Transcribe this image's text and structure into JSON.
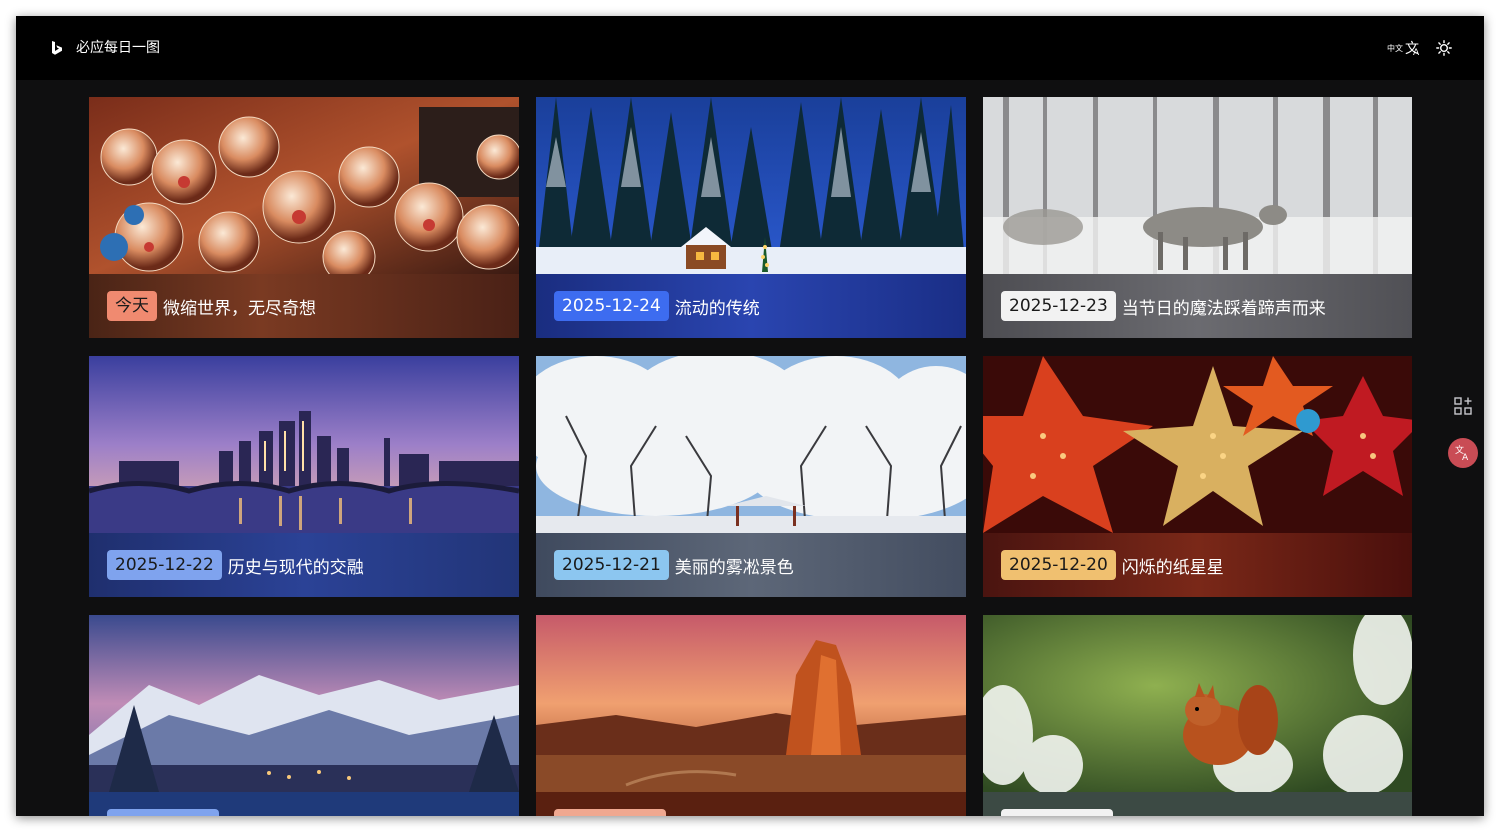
{
  "app": {
    "title": "必应每日一图"
  },
  "toolbar": {
    "translate_icon": "translate-icon",
    "theme_icon": "sun-icon"
  },
  "cards": [
    {
      "date": "今天",
      "title": "微缩世界，无尽奇想",
      "badge_color": "#f08a70",
      "band_color": "#5a2b1a"
    },
    {
      "date": "2025-12-24",
      "title": "流动的传统",
      "badge_color": "#3d6cf0",
      "band_color": "#1b2f8a"
    },
    {
      "date": "2025-12-23",
      "title": "当节日的魔法踩着蹄声而来",
      "badge_color": "#f2f2f2",
      "band_color": "#58585c"
    },
    {
      "date": "2025-12-22",
      "title": "历史与现代的交融",
      "badge_color": "#7fa3ee",
      "band_color": "#253a82"
    },
    {
      "date": "2025-12-21",
      "title": "美丽的雾凇景色",
      "badge_color": "#8cc6f0",
      "band_color": "#4a5568"
    },
    {
      "date": "2025-12-20",
      "title": "闪烁的纸星星",
      "badge_color": "#f0c070",
      "band_color": "#5b1f12"
    },
    {
      "date": "",
      "title": "",
      "badge_color": "#7fa3ee",
      "band_color": "#1f3a7a"
    },
    {
      "date": "",
      "title": "",
      "badge_color": "#f0a890",
      "band_color": "#5a2010"
    },
    {
      "date": "",
      "title": "",
      "badge_color": "#f2f2f2",
      "band_color": "#3c4a44"
    }
  ],
  "side": {
    "widget_icon": "add-widget-icon",
    "badge_icon": "translate-badge-icon",
    "badge_color": "#c94c55"
  }
}
